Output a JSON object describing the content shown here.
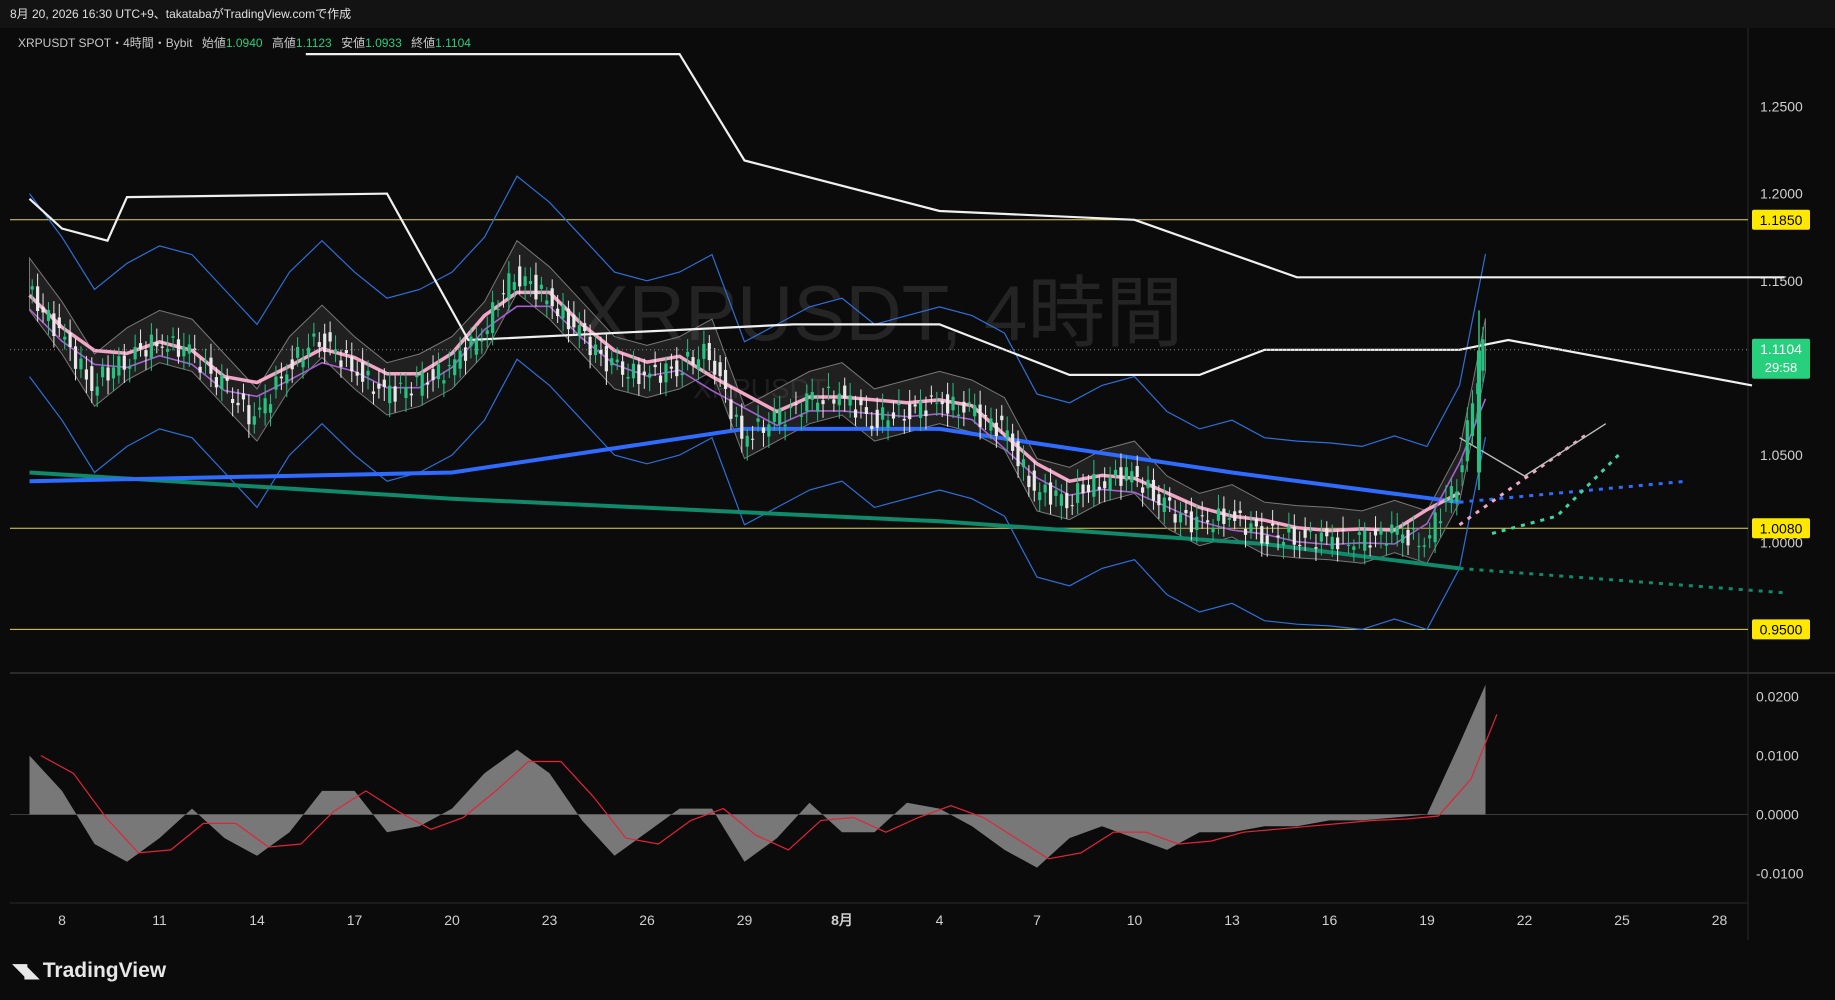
{
  "header": {
    "caption": "8月 20, 2026 16:30 UTC+9、takatabaがTradingView.comで作成"
  },
  "symbol": {
    "title": "XRPUSDT SPOT・4時間・Bybit",
    "open_label": "始値",
    "open": "1.0940",
    "high_label": "高値",
    "high": "1.1123",
    "low_label": "安値",
    "low": "1.0933",
    "close_label": "終値",
    "close": "1.1104"
  },
  "watermark": {
    "text": "XRPUSDT, 4時間",
    "sub": "XRPUSDT"
  },
  "brand": {
    "name": "TradingView"
  },
  "colors": {
    "up": "#26c281",
    "down": "#e8e8e8",
    "sma_blue": "#2f6bff",
    "sma_teal": "#0f8a6a",
    "pink": "#f2a6c6",
    "purple": "#a55fd0",
    "bb": "#2e6fd8",
    "white_line": "#f0f0f0",
    "level_line": "#e8d44d",
    "price_badge": "#26d07c",
    "level_badge": "#ffe800",
    "hist": "#8c8c8c",
    "signal": "#e0253a"
  },
  "chart_data": {
    "type": "candlestick",
    "title": "XRPUSDT SPOT・4時間・Bybit",
    "price_axis": {
      "ylim": [
        0.925,
        1.295
      ],
      "ticks": [
        1.25,
        1.2,
        1.15,
        1.05,
        1.0
      ]
    },
    "x_ticks": [
      "8",
      "11",
      "14",
      "17",
      "20",
      "23",
      "26",
      "29",
      "8月",
      "4",
      "7",
      "10",
      "13",
      "16",
      "19",
      "22",
      "25",
      "28"
    ],
    "horizontal_levels": [
      {
        "value": 1.185,
        "label": "1.1850"
      },
      {
        "value": 1.008,
        "label": "1.0080"
      },
      {
        "value": 0.95,
        "label": "0.9500"
      }
    ],
    "current_price": {
      "value": 1.1104,
      "label": "1.1104",
      "countdown": "29:58"
    },
    "close_path": [
      [
        7,
        1.145
      ],
      [
        8,
        1.12
      ],
      [
        9,
        1.09
      ],
      [
        10,
        1.105
      ],
      [
        11,
        1.115
      ],
      [
        12,
        1.11
      ],
      [
        13,
        1.09
      ],
      [
        14,
        1.07
      ],
      [
        15,
        1.1
      ],
      [
        16,
        1.118
      ],
      [
        17,
        1.1
      ],
      [
        18,
        1.085
      ],
      [
        19,
        1.09
      ],
      [
        20,
        1.1
      ],
      [
        21,
        1.12
      ],
      [
        22,
        1.155
      ],
      [
        23,
        1.14
      ],
      [
        24,
        1.12
      ],
      [
        25,
        1.1
      ],
      [
        26,
        1.095
      ],
      [
        27,
        1.1
      ],
      [
        28,
        1.11
      ],
      [
        29,
        1.06
      ],
      [
        30,
        1.07
      ],
      [
        31,
        1.08
      ],
      [
        32,
        1.085
      ],
      [
        33,
        1.07
      ],
      [
        34,
        1.075
      ],
      [
        35,
        1.08
      ],
      [
        36,
        1.075
      ],
      [
        37,
        1.065
      ],
      [
        38,
        1.03
      ],
      [
        39,
        1.025
      ],
      [
        40,
        1.035
      ],
      [
        41,
        1.04
      ],
      [
        42,
        1.02
      ],
      [
        43,
        1.01
      ],
      [
        44,
        1.015
      ],
      [
        45,
        1.005
      ],
      [
        46,
        1.003
      ],
      [
        47,
        1.002
      ],
      [
        48,
        1.0
      ],
      [
        49,
        1.006
      ],
      [
        50,
        1.0
      ],
      [
        51,
        1.035
      ],
      [
        51.8,
        1.1104
      ]
    ],
    "sma_blue": [
      [
        7,
        1.035
      ],
      [
        20,
        1.04
      ],
      [
        29,
        1.065
      ],
      [
        35,
        1.065
      ],
      [
        44,
        1.04
      ],
      [
        51,
        1.023
      ],
      [
        58,
        1.035
      ]
    ],
    "sma_teal": [
      [
        7,
        1.04
      ],
      [
        20,
        1.025
      ],
      [
        35,
        1.012
      ],
      [
        45,
        0.999
      ],
      [
        51,
        0.985
      ],
      [
        61,
        0.971
      ]
    ],
    "resistance_line": [
      [
        7,
        1.197
      ],
      [
        8,
        1.18
      ],
      [
        9.4,
        1.173
      ],
      [
        10,
        1.198
      ],
      [
        18,
        1.2
      ],
      [
        20.5,
        1.116
      ],
      [
        30.5,
        1.125
      ],
      [
        35,
        1.125
      ],
      [
        39,
        1.096
      ],
      [
        43,
        1.096
      ],
      [
        45,
        1.1104
      ],
      [
        51,
        1.1104
      ],
      [
        52.5,
        1.116
      ],
      [
        60,
        1.09
      ]
    ],
    "upper_resistance": [
      [
        15.5,
        1.28
      ],
      [
        27,
        1.28
      ],
      [
        29,
        1.219
      ],
      [
        35,
        1.19
      ],
      [
        41,
        1.185
      ],
      [
        46,
        1.152
      ],
      [
        61,
        1.152
      ]
    ],
    "projection_path": [
      [
        51,
        1.06
      ],
      [
        53,
        1.038
      ],
      [
        55.5,
        1.068
      ]
    ],
    "oscillator": {
      "ylim": [
        -0.015,
        0.024
      ],
      "ticks": [
        0.02,
        0.01,
        0.0,
        -0.01
      ],
      "tick_labels": [
        "0.0200",
        "0.0100",
        "0.0000",
        "-0.0100"
      ],
      "histogram": [
        [
          7,
          0.01
        ],
        [
          8,
          0.004
        ],
        [
          9,
          -0.005
        ],
        [
          10,
          -0.008
        ],
        [
          11,
          -0.004
        ],
        [
          12,
          0.001
        ],
        [
          13,
          -0.004
        ],
        [
          14,
          -0.007
        ],
        [
          15,
          -0.003
        ],
        [
          16,
          0.004
        ],
        [
          17,
          0.004
        ],
        [
          18,
          -0.003
        ],
        [
          19,
          -0.002
        ],
        [
          20,
          0.001
        ],
        [
          21,
          0.007
        ],
        [
          22,
          0.011
        ],
        [
          23,
          0.007
        ],
        [
          24,
          -0.001
        ],
        [
          25,
          -0.007
        ],
        [
          26,
          -0.003
        ],
        [
          27,
          0.001
        ],
        [
          28,
          0.001
        ],
        [
          29,
          -0.008
        ],
        [
          30,
          -0.004
        ],
        [
          31,
          0.002
        ],
        [
          32,
          -0.003
        ],
        [
          33,
          -0.003
        ],
        [
          34,
          0.002
        ],
        [
          35,
          0.001
        ],
        [
          36,
          -0.002
        ],
        [
          37,
          -0.006
        ],
        [
          38,
          -0.009
        ],
        [
          39,
          -0.004
        ],
        [
          40,
          -0.002
        ],
        [
          41,
          -0.004
        ],
        [
          42,
          -0.006
        ],
        [
          43,
          -0.003
        ],
        [
          44,
          -0.003
        ],
        [
          45,
          -0.002
        ],
        [
          46,
          -0.002
        ],
        [
          47,
          -0.001
        ],
        [
          48,
          -0.001
        ],
        [
          49,
          -0.0005
        ],
        [
          50,
          0.0
        ],
        [
          51,
          0.012
        ],
        [
          51.8,
          0.022
        ]
      ]
    }
  }
}
